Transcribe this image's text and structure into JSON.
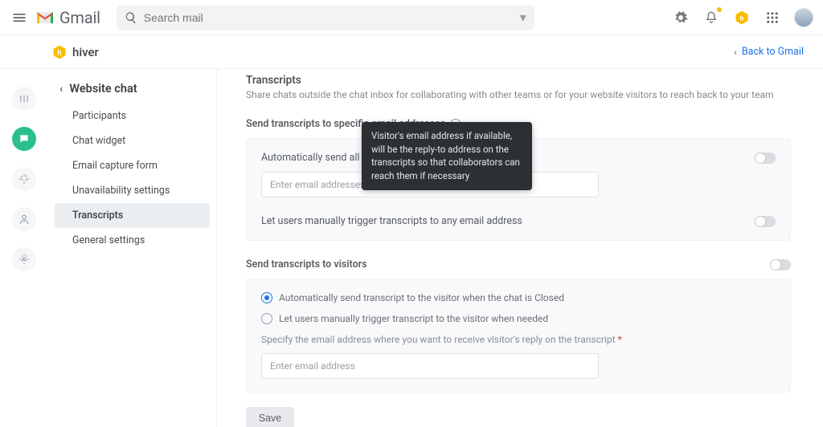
{
  "header": {
    "product": "Gmail",
    "search_placeholder": "Search mail"
  },
  "hiver_bar": {
    "brand": "hiver",
    "back_label": "Back to Gmail"
  },
  "nav": {
    "title": "Website chat",
    "items": [
      {
        "label": "Participants"
      },
      {
        "label": "Chat widget"
      },
      {
        "label": "Email capture form"
      },
      {
        "label": "Unavailability settings"
      },
      {
        "label": "Transcripts",
        "selected": true
      },
      {
        "label": "General settings"
      }
    ]
  },
  "page": {
    "title": "Transcripts",
    "subtitle": "Share chats outside the chat inbox for collaborating with other teams or for your website visitors to reach back to your team",
    "section1_title": "Send transcripts to specific email addresses",
    "tooltip": "Visitor's email address if available, will be the reply-to address on the transcripts so that collaborators can reach them if necessary",
    "auto_label": "Automatically send all transcripts to the",
    "auto_placeholder": "Enter email addresses",
    "manual_label": "Let users manually trigger transcripts to any email address",
    "section2_title": "Send transcripts to visitors",
    "radio1": "Automatically send transcript to the visitor when the chat is Closed",
    "radio2": "Let users manually trigger transcript to the visitor when needed",
    "specify_label": "Specify the email address where you want to receive visitor's reply on the transcript",
    "specify_placeholder": "Enter email address",
    "save": "Save"
  }
}
